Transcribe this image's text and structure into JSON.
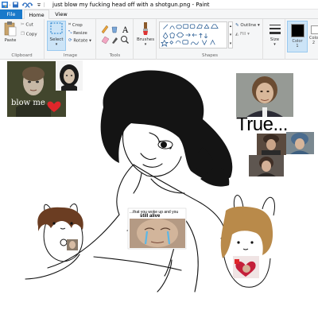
{
  "window": {
    "title": "just blow my fucking head off with a shotgun.png - Paint"
  },
  "menu": {
    "tabs": [
      {
        "label": "File"
      },
      {
        "label": "Home"
      },
      {
        "label": "View"
      }
    ],
    "active_tab": "Home"
  },
  "ribbon": {
    "clipboard": {
      "paste": "Paste",
      "cut": "Cut",
      "copy": "Copy",
      "label": "Clipboard"
    },
    "image": {
      "select": "Select",
      "crop": "Crop",
      "resize": "Resize",
      "rotate": "Rotate",
      "label": "Image"
    },
    "tools": {
      "label": "Tools"
    },
    "brushes": {
      "label": "Brushes"
    },
    "shapes": {
      "outline": "Outline",
      "fill": "Fill",
      "label": "Shapes"
    },
    "size": {
      "label": "Size"
    },
    "colors": {
      "color1_label": "Color",
      "color1_num": "1",
      "color2_label": "Colo",
      "color2_num": "2",
      "color1": "#000000",
      "color2": "#ffffff"
    }
  },
  "canvas": {
    "texts": {
      "true_caption": "True...",
      "blow_caption": "blow me",
      "meme_top": "...that you woke up and you",
      "meme_mid": "still alive"
    },
    "heart_color": "#e0262a",
    "accent_blue": "#1979ca"
  }
}
